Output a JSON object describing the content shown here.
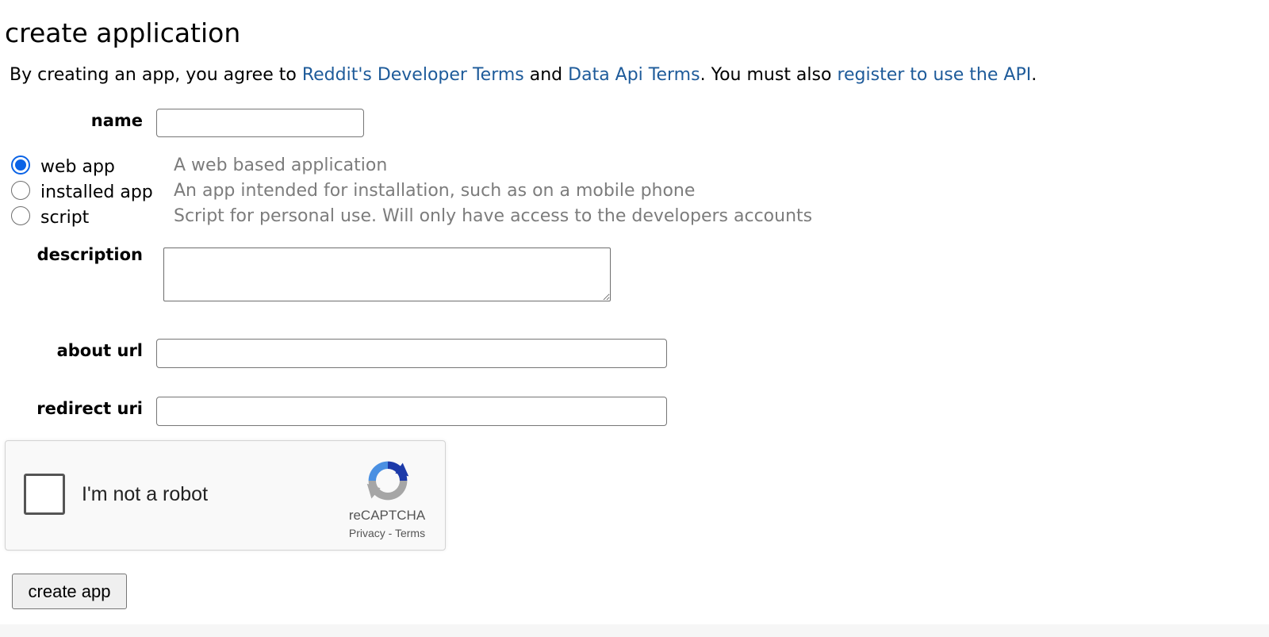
{
  "page": {
    "title": "create application"
  },
  "terms": {
    "prefix": "By creating an app, you agree to ",
    "developer_terms_link": "Reddit's Developer Terms",
    "and_text": " and ",
    "data_api_terms_link": "Data Api Terms",
    "middle_text": ". You must also ",
    "register_link": "register to use the API",
    "suffix": "."
  },
  "form": {
    "name": {
      "label": "name",
      "value": ""
    },
    "app_types": [
      {
        "label": "web app",
        "description": "A web based application",
        "selected": true
      },
      {
        "label": "installed app",
        "description": "An app intended for installation, such as on a mobile phone",
        "selected": false
      },
      {
        "label": "script",
        "description": "Script for personal use. Will only have access to the developers accounts",
        "selected": false
      }
    ],
    "description": {
      "label": "description",
      "value": ""
    },
    "about_url": {
      "label": "about url",
      "value": ""
    },
    "redirect_uri": {
      "label": "redirect uri",
      "value": ""
    },
    "submit_label": "create app"
  },
  "captcha": {
    "checkbox_label": "I'm not a robot",
    "brand": "reCAPTCHA",
    "privacy_link": "Privacy",
    "separator": " - ",
    "terms_link": "Terms"
  },
  "colors": {
    "link": "#1e5b9a",
    "radio_selected": "#0a63e6",
    "muted_text": "#7c7c7c"
  }
}
